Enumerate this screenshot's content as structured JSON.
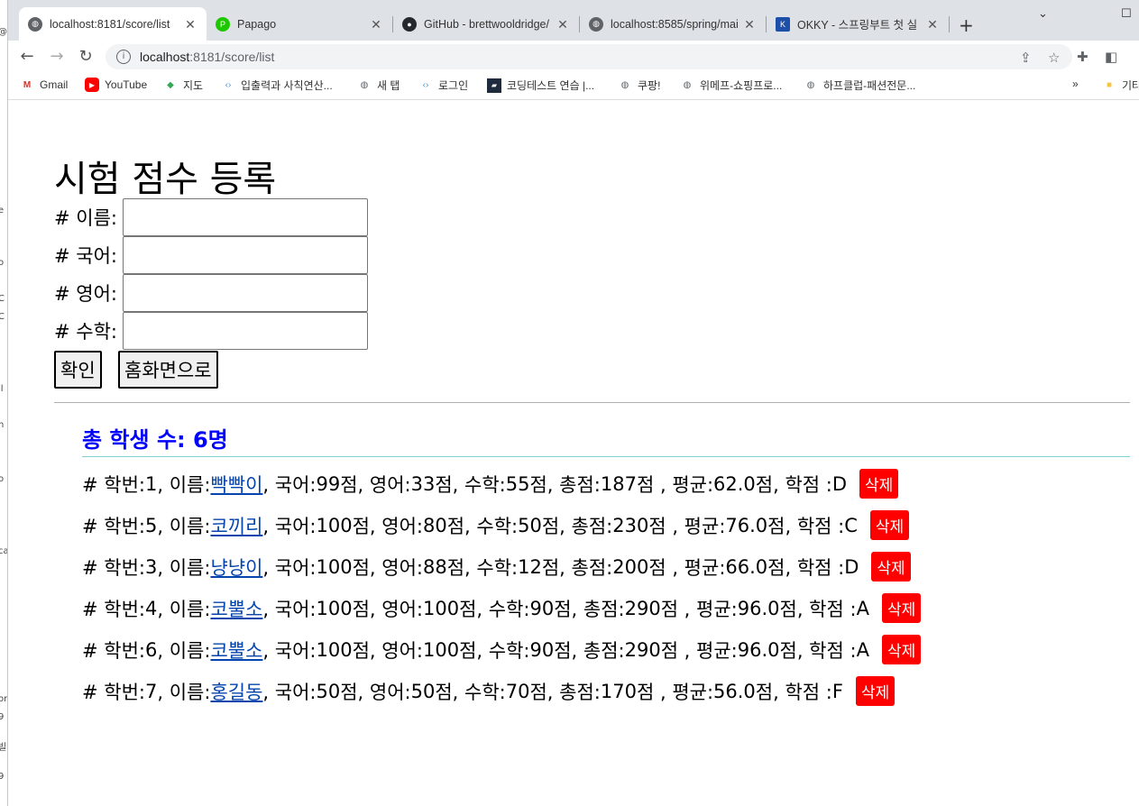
{
  "browser": {
    "tabs": [
      {
        "title": "localhost:8181/score/list",
        "icon": "globe-icon",
        "active": true
      },
      {
        "title": "Papago",
        "icon": "papago-icon",
        "active": false
      },
      {
        "title": "GitHub - brettwooldridge/",
        "icon": "github-icon",
        "active": false
      },
      {
        "title": "localhost:8585/spring/mai",
        "icon": "globe-icon",
        "active": false
      },
      {
        "title": "OKKY - 스프링부트 첫 실",
        "icon": "okky-icon",
        "active": false
      }
    ],
    "address": {
      "host": "localhost",
      "path": ":8181/score/list"
    },
    "bookmarks": [
      {
        "label": "Gmail",
        "icon": "gmail-icon"
      },
      {
        "label": "YouTube",
        "icon": "youtube-icon"
      },
      {
        "label": "지도",
        "icon": "maps-icon"
      },
      {
        "label": "입출력과 사칙연산...",
        "icon": "code-icon"
      },
      {
        "label": "새 탭",
        "icon": "globe-icon"
      },
      {
        "label": "로그인",
        "icon": "code-icon"
      },
      {
        "label": "코딩테스트 연습 |...",
        "icon": "programmers-icon"
      },
      {
        "label": "쿠팡!",
        "icon": "globe-icon"
      },
      {
        "label": "위메프-쇼핑프로...",
        "icon": "globe-icon"
      },
      {
        "label": "하프클럽-패션전문...",
        "icon": "globe-icon"
      }
    ],
    "other_bookmarks": "기타"
  },
  "page": {
    "title": "시험 점수 등록",
    "fields": [
      {
        "label": "# 이름:",
        "value": ""
      },
      {
        "label": "# 국어:",
        "value": ""
      },
      {
        "label": "# 영어:",
        "value": ""
      },
      {
        "label": "# 수학:",
        "value": ""
      }
    ],
    "confirm_label": "확인",
    "home_label": "홈화면으로",
    "count_text": "총 학생 수: 6명",
    "delete_label": "삭제",
    "students": [
      {
        "id": "1",
        "name": "빡빡이",
        "kor": "99",
        "eng": "33",
        "math": "55",
        "total": "187",
        "avg": "62.0",
        "grade": "D"
      },
      {
        "id": "5",
        "name": "코끼리",
        "kor": "100",
        "eng": "80",
        "math": "50",
        "total": "230",
        "avg": "76.0",
        "grade": "C"
      },
      {
        "id": "3",
        "name": "냥냥이",
        "kor": "100",
        "eng": "88",
        "math": "12",
        "total": "200",
        "avg": "66.0",
        "grade": "D"
      },
      {
        "id": "4",
        "name": "코뿔소",
        "kor": "100",
        "eng": "100",
        "math": "90",
        "total": "290",
        "avg": "96.0",
        "grade": "A"
      },
      {
        "id": "6",
        "name": "코뿔소",
        "kor": "100",
        "eng": "100",
        "math": "90",
        "total": "290",
        "avg": "96.0",
        "grade": "A"
      },
      {
        "id": "7",
        "name": "홍길동",
        "kor": "50",
        "eng": "50",
        "math": "70",
        "total": "170",
        "avg": "56.0",
        "grade": "F"
      }
    ]
  }
}
